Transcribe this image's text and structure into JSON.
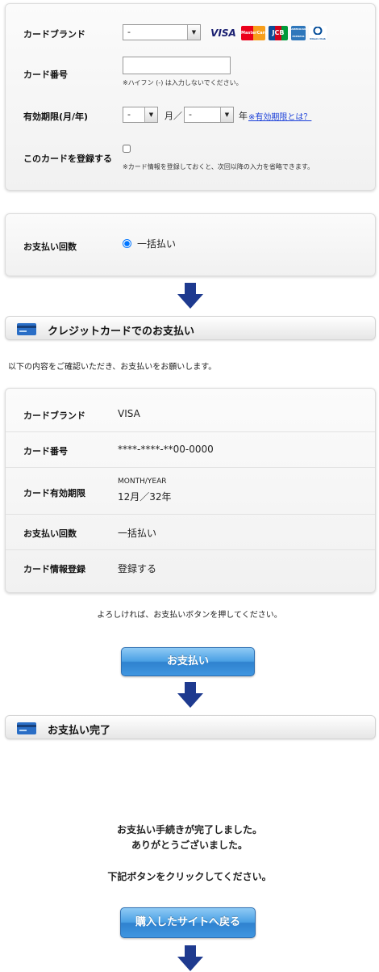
{
  "card_form": {
    "brand_label": "カードブランド",
    "brand_value": "-",
    "brand_logos": [
      "VISA",
      "MasterCard",
      "JCB",
      "AMERICAN EXPRESS",
      "Diners Club"
    ],
    "number_label": "カード番号",
    "number_value": "",
    "number_note": "※ハイフン (-) は入力しないでください。",
    "expiry_label": "有効期限(月/年)",
    "expiry_month_value": "-",
    "expiry_month_unit": "月／",
    "expiry_year_value": "-",
    "expiry_year_unit": "年",
    "expiry_help_link": "※有効期限とは？",
    "register_label": "このカードを登録する",
    "register_checked": false,
    "register_note": "※カード情報を登録しておくと、次回以降の入力を省略できます。"
  },
  "installments": {
    "label": "お支払い回数",
    "option_label": "一括払い",
    "selected": true
  },
  "confirm_section": {
    "title": "クレジットカードでのお支払い",
    "intro": "以下の内容をご確認いただき、お支払いをお願いします。",
    "rows": [
      {
        "label": "カードブランド",
        "value": "VISA"
      },
      {
        "label": "カード番号",
        "value": "****-****-**00-0000"
      },
      {
        "label": "カード有効期限",
        "caption": "MONTH/YEAR",
        "value": "12月／32年"
      },
      {
        "label": "お支払い回数",
        "value": "一括払い"
      },
      {
        "label": "カード情報登録",
        "value": "登録する"
      }
    ],
    "prompt": "よろしければ、お支払いボタンを押してください。",
    "pay_button": "お支払い"
  },
  "complete_section": {
    "title": "お支払い完了",
    "message_line1": "お支払い手続きが完了しました。",
    "message_line2": "ありがとうございました。",
    "instruction": "下記ボタンをクリックしてください。",
    "return_button": "購入したサイトへ戻る"
  },
  "colors": {
    "arrow": "#1e3a8f",
    "button_blue": "#3f96e0",
    "link_blue": "#1a3fd8"
  }
}
